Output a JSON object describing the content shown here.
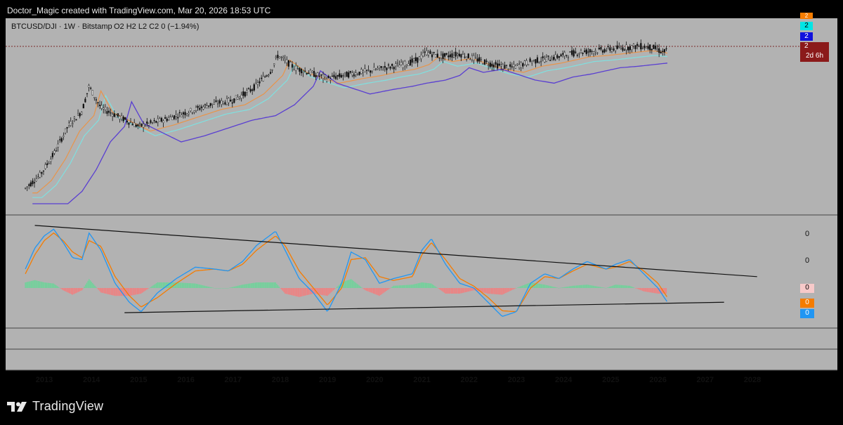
{
  "header": {
    "credit": "Doctor_Magic created with TradingView.com, Mar 20, 2026 18:53 UTC"
  },
  "legend": {
    "symbol": "BTCUSD/DJI · 1W · Bitstamp",
    "ohlc": "O2  H2  L2  C2  0 (−1.94%)"
  },
  "price_scale": {
    "tags": [
      {
        "text": "2",
        "color": "#f57c00",
        "text_color": "#ffffff"
      },
      {
        "text": "2",
        "color": "#00e5e5",
        "text_color": "#000000"
      },
      {
        "text": "2",
        "color": "#1111dd",
        "text_color": "#ffffff"
      },
      {
        "text": "2",
        "color": "#8b1a1a",
        "text_color": "#ffffff"
      },
      {
        "text": "2d 6h",
        "color": "#8b1a1a",
        "text_color": "#ffffff"
      }
    ]
  },
  "oscillator_scale": {
    "labels": [
      "0",
      "0"
    ],
    "tags": [
      {
        "text": "0",
        "color": "#f7c9c9",
        "text_color": "#000000"
      },
      {
        "text": "0",
        "color": "#f57c00",
        "text_color": "#ffffff"
      },
      {
        "text": "0",
        "color": "#2196f3",
        "text_color": "#ffffff"
      }
    ]
  },
  "time_axis": {
    "labels": [
      "2013",
      "2014",
      "2015",
      "2016",
      "2017",
      "2018",
      "2019",
      "2020",
      "2021",
      "2022",
      "2023",
      "2024",
      "2025",
      "2026",
      "2027",
      "2028"
    ]
  },
  "footer": {
    "brand": "TradingView"
  },
  "colors": {
    "chart_background": "#b2b2b2",
    "candle": "#111111",
    "ma_purple": "#5a3fd1",
    "ma_orange": "#e8944a",
    "ma_cyan": "#7fe0e0",
    "osc_blue": "#2196f3",
    "osc_orange": "#f57c00",
    "hist_positive": "#6fd39a",
    "hist_negative": "#f08080",
    "trendline": "#111111"
  },
  "chart_data": {
    "type": "line",
    "title": "BTCUSD/DJI · 1W · Bitstamp",
    "x_ticks": [
      "2013",
      "2014",
      "2015",
      "2016",
      "2017",
      "2018",
      "2019",
      "2020",
      "2021",
      "2022",
      "2023",
      "2024",
      "2025",
      "2026",
      "2027",
      "2028"
    ],
    "panes": [
      "price",
      "oscillator"
    ],
    "price_series": {
      "x": [
        2012.6,
        2012.9,
        2013.2,
        2013.5,
        2013.8,
        2013.95,
        2014.2,
        2014.6,
        2015.0,
        2015.5,
        2016.0,
        2016.5,
        2017.0,
        2017.4,
        2017.8,
        2017.95,
        2018.3,
        2018.7,
        2019.0,
        2019.5,
        2019.9,
        2020.2,
        2020.6,
        2020.9,
        2021.1,
        2021.4,
        2021.8,
        2022.1,
        2022.5,
        2022.9,
        2023.3,
        2023.7,
        2024.0,
        2024.3,
        2024.7,
        2025.0,
        2025.3,
        2025.6,
        2025.9,
        2026.1,
        2026.2
      ],
      "values_note": "relative price level, 0 = pane bottom, 100 = pane top",
      "values": [
        10,
        18,
        32,
        50,
        60,
        76,
        62,
        56,
        50,
        54,
        59,
        64,
        67,
        74,
        86,
        96,
        88,
        84,
        81,
        84,
        86,
        88,
        90,
        93,
        98,
        95,
        97,
        94,
        90,
        88,
        92,
        94,
        96,
        98,
        99,
        100,
        101,
        102,
        101,
        98,
        99
      ]
    },
    "oscillator": {
      "x": [
        2012.6,
        2012.8,
        2013.0,
        2013.2,
        2013.4,
        2013.6,
        2013.8,
        2013.95,
        2014.2,
        2014.5,
        2014.8,
        2015.05,
        2015.4,
        2015.8,
        2016.2,
        2016.6,
        2016.9,
        2017.2,
        2017.5,
        2017.9,
        2018.1,
        2018.4,
        2018.7,
        2019.0,
        2019.3,
        2019.5,
        2019.8,
        2020.1,
        2020.4,
        2020.8,
        2021.0,
        2021.2,
        2021.5,
        2021.8,
        2022.1,
        2022.4,
        2022.7,
        2023.0,
        2023.3,
        2023.6,
        2023.9,
        2024.2,
        2024.5,
        2024.9,
        2025.1,
        2025.4,
        2025.7,
        2026.0,
        2026.2
      ],
      "blue": [
        20,
        42,
        55,
        62,
        48,
        32,
        30,
        58,
        40,
        5,
        -15,
        -25,
        -5,
        10,
        22,
        20,
        18,
        28,
        45,
        60,
        40,
        10,
        -5,
        -25,
        5,
        38,
        30,
        5,
        10,
        15,
        40,
        52,
        25,
        5,
        0,
        -15,
        -30,
        -25,
        5,
        15,
        10,
        20,
        28,
        20,
        25,
        30,
        15,
        0,
        -15
      ],
      "orange": [
        15,
        35,
        50,
        58,
        50,
        38,
        32,
        50,
        44,
        12,
        -8,
        -20,
        -10,
        5,
        18,
        20,
        18,
        25,
        40,
        55,
        45,
        18,
        0,
        -18,
        0,
        30,
        32,
        12,
        8,
        12,
        35,
        48,
        30,
        10,
        2,
        -10,
        -24,
        -25,
        0,
        12,
        10,
        18,
        25,
        20,
        22,
        28,
        18,
        5,
        -10
      ]
    },
    "trendlines": [
      {
        "name": "upper",
        "from": [
          2012.8,
          66
        ],
        "to": [
          2028.1,
          12
        ]
      },
      {
        "name": "lower",
        "from": [
          2014.7,
          -26
        ],
        "to": [
          2027.4,
          -15
        ]
      }
    ]
  }
}
